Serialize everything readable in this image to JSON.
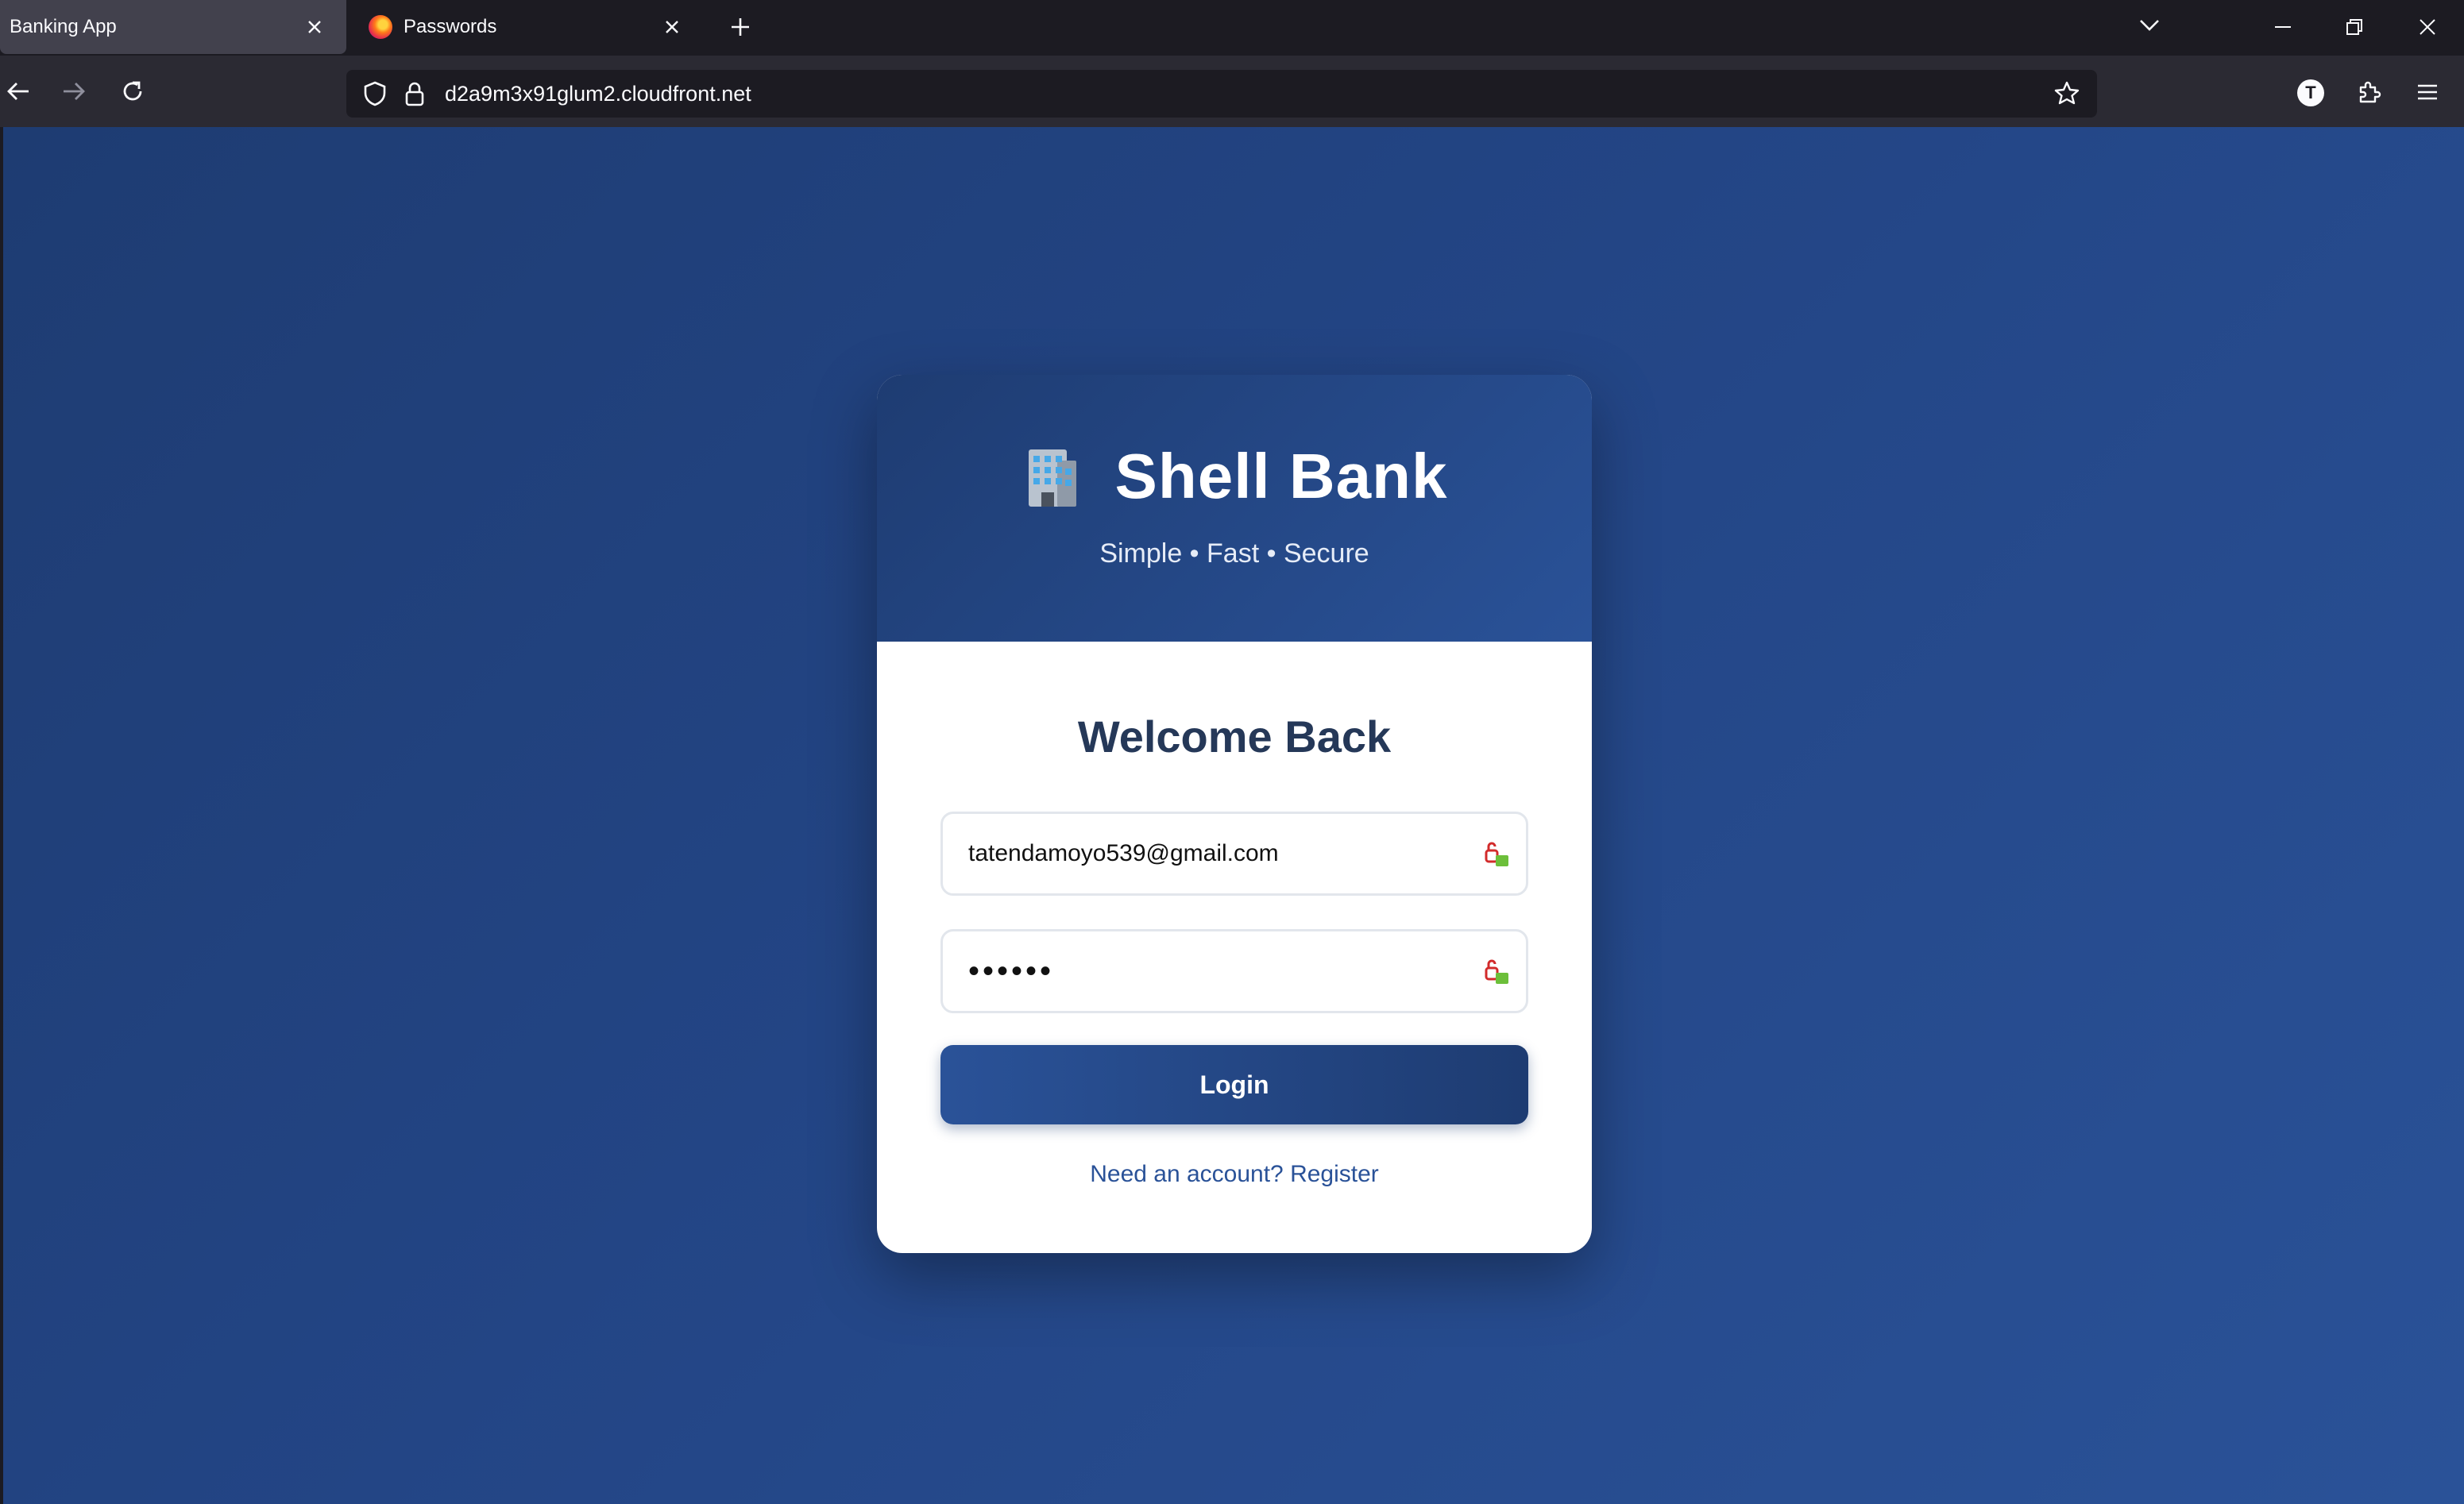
{
  "browser": {
    "tabs": [
      {
        "title": "Banking App",
        "active": true
      },
      {
        "title": "Passwords",
        "active": false
      }
    ],
    "url": "d2a9m3x91glum2.cloudfront.net",
    "account_initial": "T"
  },
  "page": {
    "brand_title": "Shell Bank",
    "tagline": "Simple • Fast • Secure",
    "welcome_heading": "Welcome Back",
    "email_value": "tatendamoyo539@gmail.com",
    "password_value": "••••••",
    "login_label": "Login",
    "register_link": "Need an account? Register"
  },
  "colors": {
    "background_start": "#1e3c72",
    "background_end": "#2a5298",
    "card": "#ffffff",
    "heading": "#253858",
    "link": "#2a5298"
  },
  "icons": [
    "building-icon",
    "shield-icon",
    "lock-icon",
    "star-icon",
    "password-manager-icon"
  ]
}
